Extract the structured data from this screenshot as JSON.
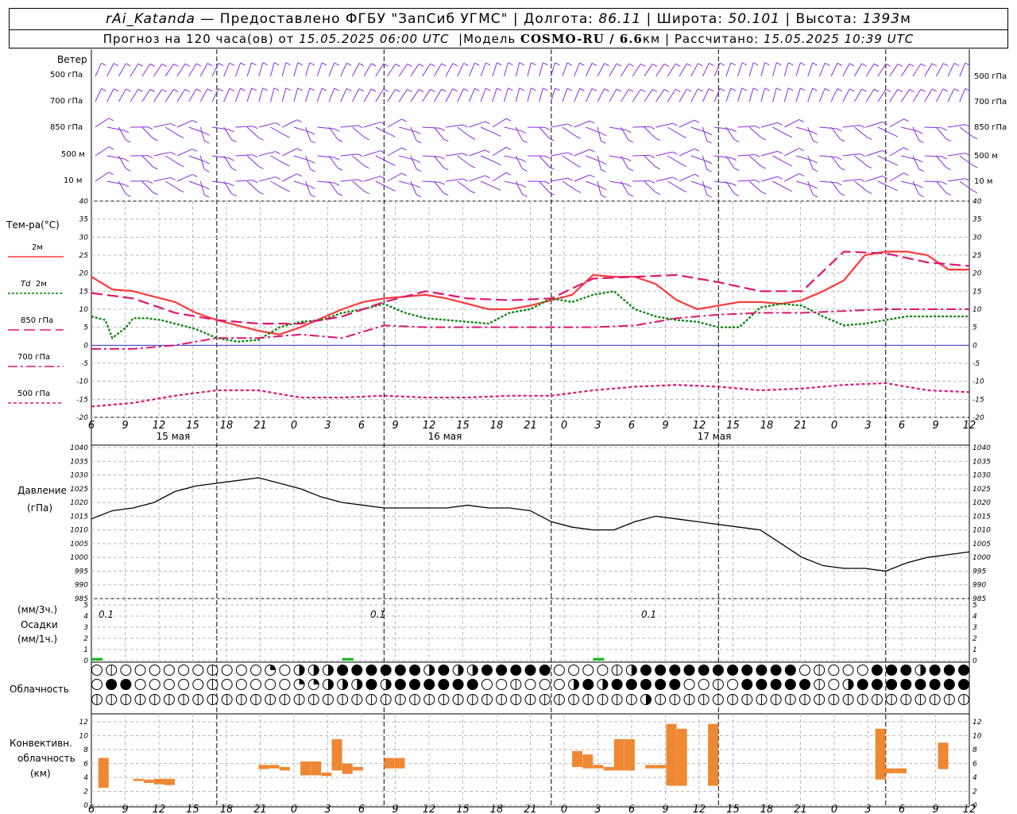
{
  "header": {
    "station": "rAi_Katanda",
    "provider": "— Предоставлено ФГБУ \"ЗапСиб УГМС\"",
    "lon_label": "Долгота:",
    "lon": "86.11",
    "lat_label": "Широта:",
    "lat": "50.101",
    "alt_label": "Высота:",
    "alt": "1393",
    "alt_unit": "м",
    "forecast_label": "Прогноз на 120 часа(ов) от",
    "forecast_start": "15.05.2025 06:00 UTC",
    "model_label": "Модель",
    "model": "COSMO-RU / 6.6",
    "model_unit": "км",
    "calc_label": "Рассчитано:",
    "calc_time": "15.05.2025 10:39 UTC"
  },
  "wind_panel": {
    "title": "Ветер",
    "levels": [
      "500 гПа",
      "700 гПа",
      "850 гПа",
      "500 м",
      "10 м"
    ]
  },
  "temp_panel": {
    "title": "Тем-ра(°C)",
    "legend": [
      {
        "label": "2м",
        "color": "#ff3a3a",
        "style": "solid"
      },
      {
        "label_italic": "Td",
        "label": "2м",
        "color": "#008000",
        "style": "dotted"
      },
      {
        "label": "850 гПа",
        "color": "#e0156e",
        "style": "longdash"
      },
      {
        "label": "700 гПа",
        "color": "#e0156e",
        "style": "dashdot"
      },
      {
        "label": "500 гПа",
        "color": "#e0156e",
        "style": "shortdash"
      }
    ]
  },
  "pressure_panel": {
    "title": "Давление",
    "unit": "(гПа)"
  },
  "precip_panel": {
    "unit3": "(мм/3ч.)",
    "title": "Осадки",
    "unit1": "(мм/1ч.)",
    "totals": [
      "0.1",
      "0.1",
      "0.1"
    ]
  },
  "cloud_panel": {
    "title": "Облачность"
  },
  "conv_panel": {
    "title1": "Конвективн.",
    "title2": "облачность",
    "unit": "(км)"
  },
  "time_axis": {
    "hour_labels": [
      "6",
      "9",
      "12",
      "15",
      "18",
      "21",
      "0",
      "3",
      "6",
      "9",
      "12",
      "15",
      "18",
      "21",
      "0",
      "3",
      "6",
      "9",
      "12",
      "15",
      "18",
      "21",
      "0",
      "3",
      "6",
      "9",
      "12"
    ],
    "day_labels": [
      "15 мая",
      "16 мая",
      "17 мая"
    ]
  },
  "chart_data": [
    {
      "type": "line",
      "title": "Тем-ра(°C)",
      "x_unit": "hours from 15.05.2025 06 UTC",
      "ylim": [
        -20,
        40
      ],
      "yticks": [
        -20,
        -15,
        -10,
        -5,
        0,
        5,
        10,
        15,
        20,
        25,
        30,
        35,
        40
      ],
      "series": [
        {
          "name": "2м",
          "x": [
            0,
            3,
            6,
            9,
            12,
            15,
            18,
            21,
            24,
            27,
            30,
            33,
            36,
            39,
            42,
            45,
            48,
            51,
            54,
            57,
            60,
            63,
            66,
            69,
            72,
            75,
            78,
            81,
            84,
            87,
            90,
            93,
            96,
            99,
            102,
            105,
            108,
            111,
            114,
            117,
            120,
            123,
            126
          ],
          "y": [
            19,
            15.5,
            15,
            13.5,
            12,
            9,
            7,
            5.5,
            4,
            3,
            5,
            7.5,
            10,
            12,
            13,
            13.5,
            14,
            13,
            11.5,
            10,
            10,
            11,
            12.5,
            14,
            19.5,
            19,
            19,
            17,
            12.5,
            10,
            11,
            12,
            12,
            11.5,
            12.5,
            15,
            18,
            25,
            26,
            26,
            25,
            21,
            21
          ]
        },
        {
          "name": "Td 2м",
          "x": [
            0,
            2,
            3,
            5,
            6,
            8,
            10,
            12,
            15,
            18,
            21,
            24,
            27,
            30,
            33,
            36,
            39,
            42,
            45,
            48,
            51,
            54,
            57,
            60,
            63,
            66,
            69,
            72,
            75,
            78,
            81,
            84,
            87,
            90,
            93,
            96,
            99,
            102,
            105,
            108,
            111,
            114,
            117,
            120,
            123,
            126
          ],
          "y": [
            8,
            7,
            2,
            5,
            7.5,
            7.5,
            7,
            6,
            4.5,
            2,
            1,
            1.5,
            5,
            6.5,
            7,
            9,
            10,
            11.5,
            9,
            7.5,
            7,
            6.5,
            6,
            9,
            10,
            13,
            12,
            14,
            15,
            10,
            8,
            7,
            6.5,
            5,
            5,
            10.5,
            11.5,
            11,
            8,
            5.5,
            6,
            7,
            8,
            8,
            8,
            8
          ]
        },
        {
          "name": "850 гПа",
          "x": [
            0,
            6,
            12,
            18,
            24,
            30,
            36,
            42,
            48,
            54,
            60,
            66,
            72,
            78,
            84,
            90,
            96,
            102,
            108,
            114,
            120,
            126
          ],
          "y": [
            14.5,
            13,
            9,
            7,
            6,
            6,
            8,
            12,
            15,
            13,
            12.5,
            13,
            18.5,
            19,
            19.5,
            17.5,
            15,
            15,
            26,
            25.5,
            23,
            22
          ]
        },
        {
          "name": "700 гПа",
          "x": [
            0,
            6,
            12,
            18,
            24,
            30,
            36,
            42,
            48,
            54,
            60,
            66,
            72,
            78,
            84,
            90,
            96,
            102,
            108,
            114,
            120,
            126
          ],
          "y": [
            -1,
            -1,
            0,
            2,
            2,
            3,
            2,
            5.5,
            5,
            5,
            5,
            5,
            5,
            5.5,
            7.5,
            8.5,
            9,
            9,
            9.5,
            10,
            10,
            10
          ]
        },
        {
          "name": "500 гПа",
          "x": [
            0,
            6,
            12,
            18,
            24,
            30,
            36,
            42,
            48,
            54,
            60,
            66,
            72,
            78,
            84,
            90,
            96,
            102,
            108,
            114,
            120,
            126
          ],
          "y": [
            -17,
            -16,
            -14,
            -12.5,
            -12.5,
            -14.5,
            -14.5,
            -14,
            -14.5,
            -14.5,
            -14,
            -14,
            -12.5,
            -11.5,
            -11,
            -11.5,
            -12.5,
            -12,
            -11,
            -10.5,
            -12.5,
            -13
          ]
        }
      ]
    },
    {
      "type": "line",
      "title": "Давление",
      "ylabel": "(гПа)",
      "ylim": [
        985,
        1040
      ],
      "yticks": [
        985,
        990,
        995,
        1000,
        1005,
        1010,
        1015,
        1020,
        1025,
        1030,
        1035,
        1040
      ],
      "series": [
        {
          "name": "Давление",
          "x": [
            0,
            3,
            6,
            9,
            12,
            15,
            18,
            21,
            24,
            27,
            30,
            33,
            36,
            39,
            42,
            45,
            48,
            51,
            54,
            57,
            60,
            63,
            66,
            69,
            72,
            75,
            78,
            81,
            84,
            87,
            90,
            93,
            96,
            99,
            102,
            105,
            108,
            111,
            114,
            117,
            120,
            123,
            126
          ],
          "y": [
            1014,
            1017,
            1018,
            1020,
            1024,
            1026,
            1027,
            1028,
            1029,
            1027,
            1025,
            1022,
            1020,
            1019,
            1018,
            1018,
            1018,
            1018,
            1019,
            1018,
            1018,
            1017,
            1013,
            1011,
            1010,
            1010,
            1013,
            1015,
            1014,
            1013,
            1012,
            1011,
            1010,
            1005,
            1000,
            997,
            996,
            996,
            995,
            998,
            1000,
            1001,
            1002
          ]
        }
      ]
    },
    {
      "type": "bar",
      "title": "Осадки",
      "ylabel": "(мм/3ч.)",
      "ylim": [
        0,
        5
      ],
      "yticks": [
        0,
        1,
        2,
        3,
        4,
        5
      ],
      "bars": [
        {
          "x": 0,
          "value": 0.1
        },
        {
          "x": 36,
          "value": 0.1
        },
        {
          "x": 72,
          "value": 0.1
        }
      ]
    },
    {
      "type": "bar",
      "title": "Конвективн. облачность",
      "ylabel": "(км)",
      "ylim": [
        0,
        12
      ],
      "yticks": [
        0,
        2,
        4,
        6,
        8,
        10,
        12
      ],
      "bars": [
        {
          "x": 1,
          "bottom": 2.5,
          "top": 6.8
        },
        {
          "x": 6,
          "bottom": 3.5,
          "top": 3.8
        },
        {
          "x": 7.5,
          "bottom": 3.2,
          "top": 3.7
        },
        {
          "x": 9,
          "bottom": 3.0,
          "top": 3.8
        },
        {
          "x": 10.5,
          "bottom": 2.9,
          "top": 3.8
        },
        {
          "x": 24,
          "bottom": 5.2,
          "top": 5.8
        },
        {
          "x": 25.5,
          "bottom": 5.3,
          "top": 5.8
        },
        {
          "x": 27,
          "bottom": 5.0,
          "top": 5.5
        },
        {
          "x": 30,
          "bottom": 4.3,
          "top": 6.3
        },
        {
          "x": 31.5,
          "bottom": 4.3,
          "top": 6.3
        },
        {
          "x": 33,
          "bottom": 4.2,
          "top": 4.7
        },
        {
          "x": 34.5,
          "bottom": 5.0,
          "top": 9.5
        },
        {
          "x": 36,
          "bottom": 4.5,
          "top": 6.0
        },
        {
          "x": 37.5,
          "bottom": 5.0,
          "top": 5.5
        },
        {
          "x": 42,
          "bottom": 5.3,
          "top": 6.8
        },
        {
          "x": 43.5,
          "bottom": 5.3,
          "top": 6.8
        },
        {
          "x": 69,
          "bottom": 5.5,
          "top": 7.8
        },
        {
          "x": 70.5,
          "bottom": 5.3,
          "top": 7.3
        },
        {
          "x": 72,
          "bottom": 5.3,
          "top": 5.8
        },
        {
          "x": 73.5,
          "bottom": 5.0,
          "top": 5.5
        },
        {
          "x": 75,
          "bottom": 5.0,
          "top": 9.5
        },
        {
          "x": 76.5,
          "bottom": 5.0,
          "top": 9.5
        },
        {
          "x": 79.5,
          "bottom": 5.3,
          "top": 5.8
        },
        {
          "x": 81,
          "bottom": 5.3,
          "top": 5.8
        },
        {
          "x": 82.5,
          "bottom": 2.8,
          "top": 11.7
        },
        {
          "x": 84,
          "bottom": 2.8,
          "top": 11.0
        },
        {
          "x": 88.5,
          "bottom": 2.8,
          "top": 11.7
        },
        {
          "x": 112.5,
          "bottom": 3.7,
          "top": 11.0
        },
        {
          "x": 114,
          "bottom": 4.6,
          "top": 5.3
        },
        {
          "x": 115.5,
          "bottom": 4.6,
          "top": 5.3
        },
        {
          "x": 121.5,
          "bottom": 5.2,
          "top": 9.0
        }
      ]
    }
  ],
  "colors": {
    "wind": "#8a2be2",
    "t2m": "#ff3a3a",
    "td2m": "#008000",
    "upper": "#e0156e",
    "zero_line": "#3333cc",
    "precip": "#22bb22",
    "convective": "#ee8833"
  },
  "cloud_rows_note": "three rows of cloud cover circles: top, middle, bottom levels"
}
